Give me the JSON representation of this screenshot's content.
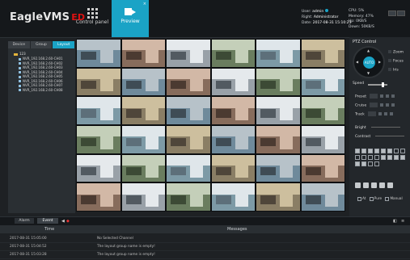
{
  "app": {
    "logo_text": "EagleVMS",
    "logo_suffix": "ED"
  },
  "nav": {
    "control_label": "Control panel",
    "preview_label": "Preview",
    "preview_close": "×"
  },
  "user": {
    "user_label": "User:",
    "user_value": "admin",
    "right_label": "Right:",
    "right_value": "Administrator",
    "date_label": "Date:",
    "date_value": "2017-08-31 15:10:23"
  },
  "system": {
    "cpu": "CPU: 5%",
    "memory": "Memory: 47%",
    "up": "Up: 0KB/S",
    "down": "Down: 50KB/S"
  },
  "left_panel": {
    "tabs": [
      {
        "label": "Device",
        "active": false
      },
      {
        "label": "Group",
        "active": false
      },
      {
        "label": "Layout",
        "active": true
      }
    ],
    "tree_root": "123",
    "tree_items": [
      "NVR_192.168.2.60-CH01",
      "NVR_192.168.2.60-CH02",
      "NVR_192.168.2.60-CH03",
      "NVR_192.168.2.60-CH04",
      "NVR_192.168.2.60-CH05",
      "NVR_192.168.2.60-CH06",
      "NVR_192.168.2.60-CH07",
      "NVR_192.168.2.60-CH08"
    ]
  },
  "ptz": {
    "title": "PTZ Control",
    "auto_label": "AUTO",
    "zoom_label": "Zoom",
    "focus_label": "Focus",
    "iris_label": "Iris",
    "speed_label": "Speed",
    "speed_value": 0.75,
    "preset_label": "Preset",
    "cruise_label": "Cruise",
    "track_label": "Track",
    "preset_value": "1",
    "cruise_value": "1",
    "track_value": "1",
    "bright_label": "Bright",
    "contrast_label": "Contrast",
    "mode_labels": [
      "At",
      "Pure",
      "Manual"
    ]
  },
  "bottom": {
    "alarm_tab": "Alarm",
    "event_tab": "Event"
  },
  "log": {
    "col_time": "Time",
    "col_messages": "Messages",
    "rows": [
      {
        "time": "2017-08-31 15:05:00",
        "message": "No Selected Channel"
      },
      {
        "time": "2017-08-31 15:04:52",
        "message": "The layout group name is empty!"
      },
      {
        "time": "2017-08-31 15:03:28",
        "message": "The layout group name is empty!"
      }
    ]
  },
  "colors": {
    "accent": "#1aa3c6",
    "background": "#1e2124",
    "header": "#15181b"
  }
}
